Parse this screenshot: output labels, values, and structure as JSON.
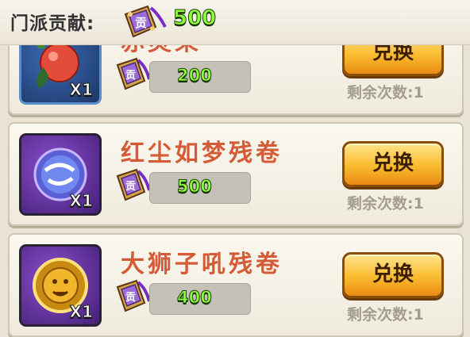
{
  "header": {
    "label": "门派贡献:",
    "amount": "500"
  },
  "items": [
    {
      "name": "赤灵果",
      "quantity": "X1",
      "price": "200",
      "button": "兑换",
      "remaining": "剩余次数:1"
    },
    {
      "name": "红尘如梦残卷",
      "quantity": "X1",
      "price": "500",
      "button": "兑换",
      "remaining": "剩余次数:1"
    },
    {
      "name": "大狮子吼残卷",
      "quantity": "X1",
      "price": "400",
      "button": "兑换",
      "remaining": "剩余次数:1"
    }
  ],
  "icons": {
    "currency": "contribution-token-icon",
    "item_1": "red-fruit-icon",
    "item_2": "dream-scroll-icon",
    "item_3": "lion-roar-icon"
  },
  "colors": {
    "accent_green": "#8dff3d",
    "item_name": "#d55b36",
    "button_gold": "#f9bb2e",
    "frame_purple": "#6a34a6",
    "frame_blue": "#2e5a9b"
  }
}
